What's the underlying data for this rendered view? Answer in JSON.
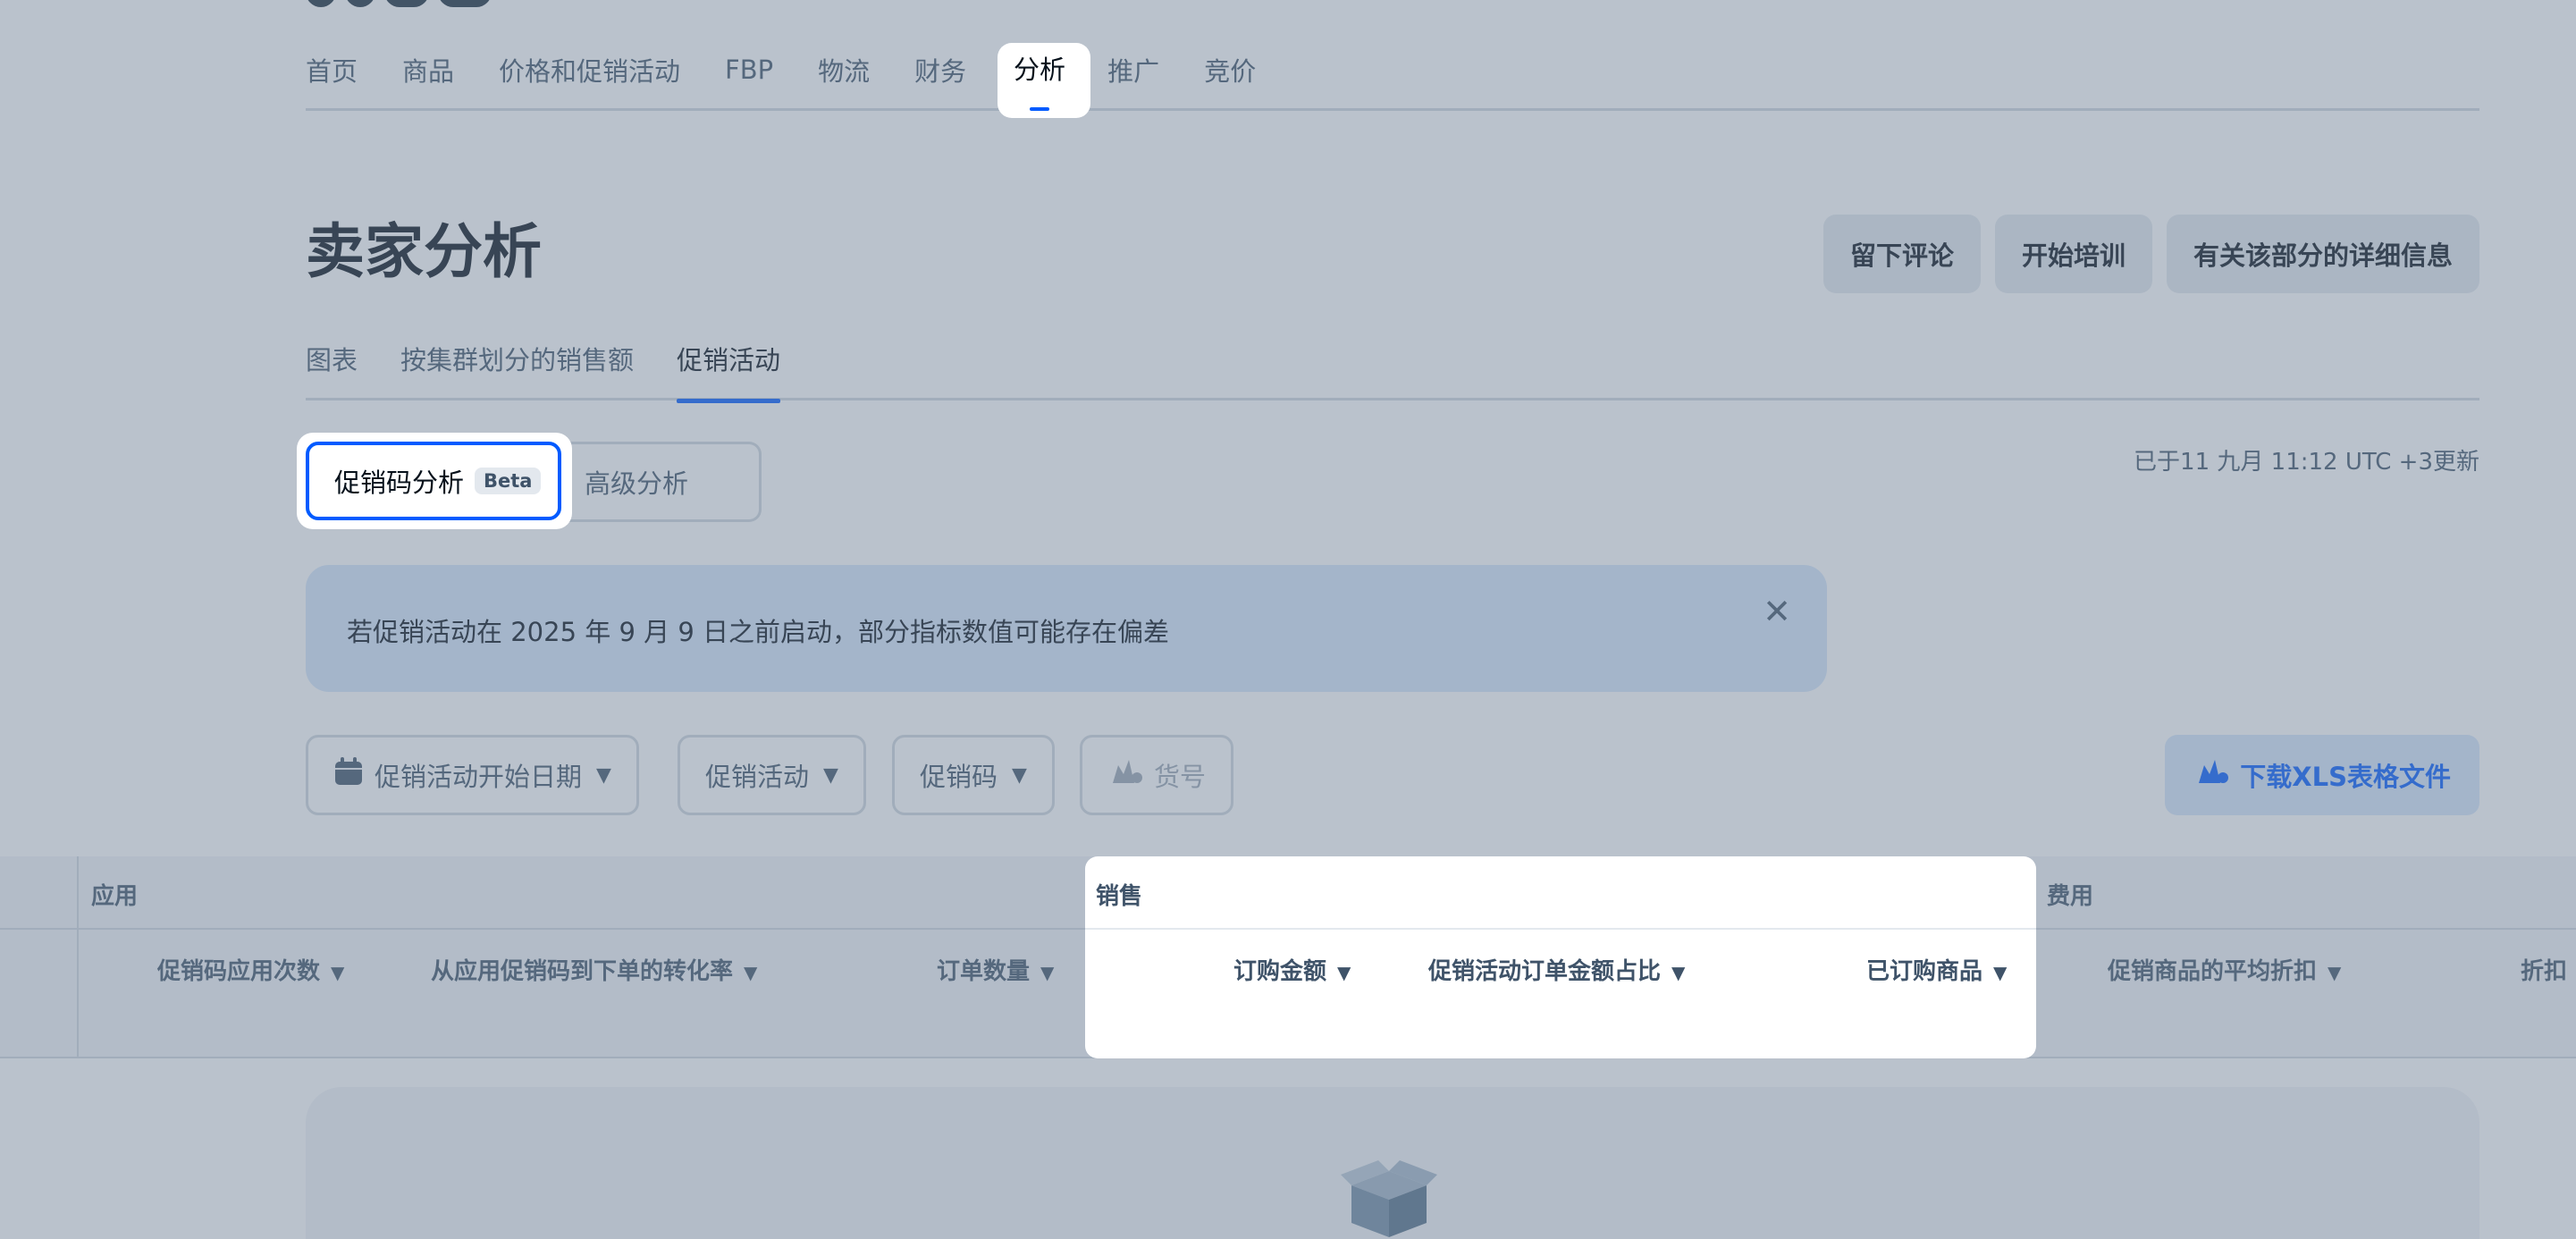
{
  "nav": {
    "items": [
      {
        "label": "首页"
      },
      {
        "label": "商品"
      },
      {
        "label": "价格和促销活动"
      },
      {
        "label": "FBP"
      },
      {
        "label": "物流"
      },
      {
        "label": "财务"
      },
      {
        "label": "分析",
        "active": true
      },
      {
        "label": "推广"
      },
      {
        "label": "竞价"
      }
    ]
  },
  "header": {
    "title": "卖家分析",
    "buttons": {
      "review": "留下评论",
      "training": "开始培训",
      "details": "有关该部分的详细信息"
    }
  },
  "subtabs": {
    "items": [
      {
        "label": "图表"
      },
      {
        "label": "按集群划分的销售额"
      },
      {
        "label": "促销活动",
        "active": true
      }
    ]
  },
  "segments": {
    "promo_code": "促销码分析",
    "beta": "Beta",
    "advanced": "高级分析"
  },
  "update_time": "已于11 九月 11:12 UTC +3更新",
  "banner": {
    "text": "若促销活动在 2025 年 9 月 9 日之前启动，部分指标数值可能存在偏差"
  },
  "filters": {
    "start_date": "促销活动开始日期",
    "campaign": "促销活动",
    "promo_code": "促销码",
    "sku": "货号"
  },
  "download": "下载XLS表格文件",
  "table": {
    "groups": {
      "apply": "应用",
      "sales": "销售",
      "cost": "费用"
    },
    "columns": {
      "apply_count": "促销码应用次数",
      "conversion": "从应用促销码到下单的转化率",
      "order_count": "订单数量",
      "order_amount": "订购金额",
      "promo_share": "促销活动订单金额占比",
      "ordered_items": "已订购商品",
      "avg_discount": "促销商品的平均折扣",
      "discount": "折扣"
    }
  },
  "colors": {
    "accent": "#005bff",
    "text": "#07111b",
    "muted": "#3f5369",
    "banner_bg": "#d5e6fb"
  }
}
